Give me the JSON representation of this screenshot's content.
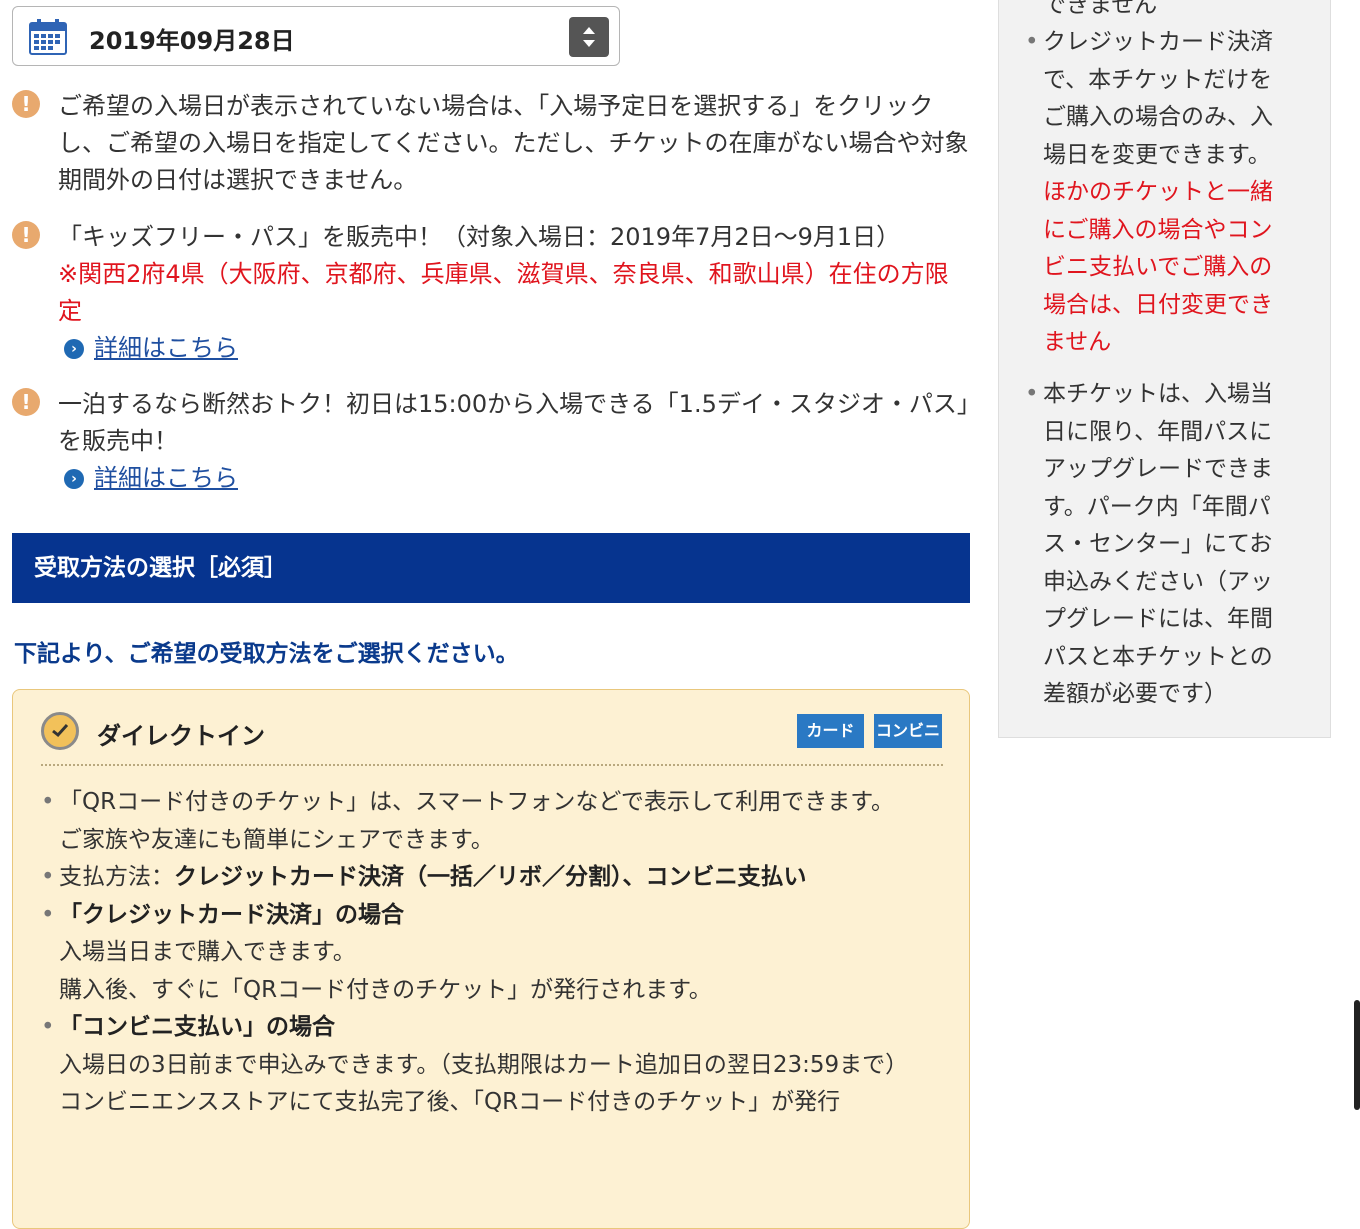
{
  "date_selector": {
    "value": "2019年09月28日",
    "icon": "calendar-icon",
    "control_icon": "up-down-stepper-icon"
  },
  "notices": [
    {
      "text": "ご希望の入場日が表示されていない場合は、「入場予定日を選択する」をクリックし、ご希望の入場日を指定してください。ただし、チケットの在庫がない場合や対象期間外の日付は選択できません。"
    },
    {
      "text": "「キッズフリー・パス」を販売中！（対象入場日：2019年7月2日〜9月1日）",
      "red": "※関西2府4県（大阪府、京都府、兵庫県、滋賀県、奈良県、和歌山県）在住の方限定",
      "link": "詳細はこちら"
    },
    {
      "text": "一泊するなら断然おトク！初日は15:00から入場できる「1.5デイ・スタジオ・パス」を販売中！",
      "link": "詳細はこちら"
    }
  ],
  "section": {
    "title": "受取方法の選択［必須］",
    "instruction": "下記より、ご希望の受取方法をご選択ください。"
  },
  "option": {
    "title": "ダイレクトイン",
    "badges": [
      "カード",
      "コンビニ"
    ],
    "line1": "「QRコード付きのチケット」は、スマートフォンなどで表示して利用できます。",
    "line1b": "ご家族や友達にも簡単にシェアできます。",
    "pay_label": "支払方法：",
    "pay_value": "クレジットカード決済（一括／リボ／分割）、コンビニ支払い",
    "card_heading": "「クレジットカード決済」の場合",
    "card_1": "入場当日まで購入できます。",
    "card_2": "購入後、すぐに「QRコード付きのチケット」が発行されます。",
    "conv_heading": "「コンビニ支払い」の場合",
    "conv_1": "入場日の3日前まで申込みできます。（支払期限はカート追加日の翌日23:59まで）",
    "conv_2": "コンビニエンスストアにて支払完了後、「QRコード付きのチケット」が発行"
  },
  "sidebar": {
    "partial_top": "できません",
    "item1_text": "クレジットカード決済で、本チケットだけをご購入の場合のみ、入場日を変更できます。",
    "item1_red": "ほかのチケットと一緒にご購入の場合やコンビニ支払いでご購入の場合は、日付変更できません",
    "item2_text": "本チケットは、入場当日に限り、年間パスにアップグレードできます。パーク内「年間パス・センター」にてお申込みください（アップグレードには、年間パスと本チケットとの差額が必要です）"
  },
  "colors": {
    "section_bar": "#06348f",
    "red": "#e0151e",
    "option_bg": "#fdf1d3",
    "badge": "#2a79c4",
    "warn": "#e8a96e"
  }
}
